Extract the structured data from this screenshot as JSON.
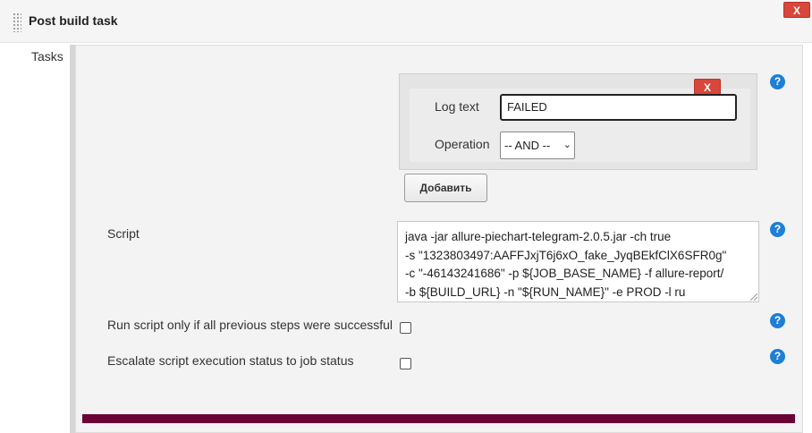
{
  "header": {
    "title": "Post build task",
    "close_label": "X"
  },
  "tasks": {
    "label": "Tasks",
    "log_rule": {
      "delete_label": "X",
      "log_text_label": "Log text",
      "log_text_value": "FAILED",
      "operation_label": "Operation",
      "operation_selected": "-- AND --"
    },
    "add_button_label": "Добавить",
    "script": {
      "label": "Script",
      "lines": [
        "java -jar allure-piechart-telegram-2.0.5.jar -ch true",
        "-s \"1323803497:AAFFJxjT6j6xO_fake_JyqBEkfClX6SFR0g\"",
        "-c \"-46143241686\" -p ${JOB_BASE_NAME} -f allure-report/",
        "-b ${BUILD_URL} -n \"${RUN_NAME}\" -e PROD -l ru"
      ]
    },
    "run_only_if_success": {
      "label": "Run script only if all previous steps were successful",
      "checked": false
    },
    "escalate_status": {
      "label": "Escalate script execution status to job status",
      "checked": false
    },
    "help_glyph": "?"
  },
  "colors": {
    "delete_red": "#d9463a",
    "help_blue": "#1d7fd6",
    "bottom_bar": "#6a0436"
  }
}
